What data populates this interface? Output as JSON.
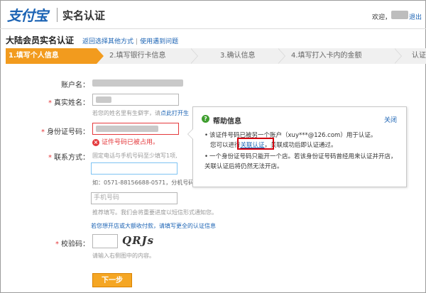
{
  "header": {
    "logo": "支付宝",
    "page_title": "实名认证",
    "welcome": "欢迎，",
    "logout": "退出"
  },
  "title": {
    "text": "大陆会员实名认证",
    "link_other": "返回选择其他方式",
    "link_help": "使用遇到问题"
  },
  "steps": [
    {
      "label": "1.填写个人信息",
      "active": true
    },
    {
      "label": "2.填写银行卡信息",
      "active": false
    },
    {
      "label": "3.确认信息",
      "active": false
    },
    {
      "label": "4.填写打入卡内的金额",
      "active": false
    },
    {
      "label": "认证",
      "active": false
    }
  ],
  "form": {
    "account_label": "账户名：",
    "realname_label": "真实姓名：",
    "realname_hint": "若您的姓名里有生僻字，请",
    "realname_hint_link": "点此打开生",
    "id_label": "身份证号码：",
    "id_error": "证件号码已被占用。",
    "contact_label": "联系方式：",
    "contact_hint": "固定电话与手机号码至少填写1项,",
    "phone_example": "如：0571-88156688-0571，分机号码",
    "mobile_placeholder": "手机号码",
    "mobile_hint": "推荐填写。我们会将重要进度以短信形式通知您。",
    "shop_link": "若您想开店或大额收付款，请填写更全的认证信息",
    "captcha_label": "校验码：",
    "captcha_text": "QRJs",
    "captcha_hint": "请输入右侧图中的内容。",
    "next_button": "下一步"
  },
  "popup": {
    "title": "帮助信息",
    "close": "关闭",
    "line1a": "该证件号码已被另一个账户（",
    "line1_email": "xuy***@126.com",
    "line1b": "）用于认证。",
    "line2a": "您可以进行",
    "line2_link": "关联认证",
    "line2b": "，关联成功后即认证通过。",
    "line3": "一个身份证号码只能开一个店。若该身份证号码曾经用来认证并开店，关联认证后将仍然无法开店。"
  }
}
